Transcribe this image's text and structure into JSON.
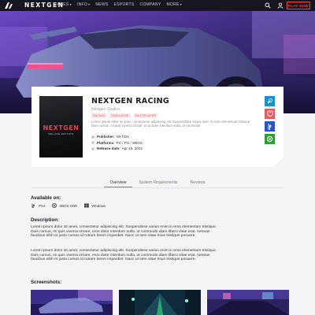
{
  "nav": {
    "brand": "NEXTGEN",
    "links": [
      {
        "label": "GAMES",
        "has_caret": true
      },
      {
        "label": "INFO",
        "has_caret": true
      },
      {
        "label": "NEWS",
        "has_caret": false
      },
      {
        "label": "ESPORTS",
        "has_caret": false
      },
      {
        "label": "COMPANY",
        "has_caret": false
      },
      {
        "label": "MORE",
        "has_caret": true
      }
    ],
    "caret": "▾",
    "icons": [
      "search-icon",
      "user-icon"
    ],
    "cta": "PLAY NOW",
    "cta_color": "#e8424c"
  },
  "game": {
    "title": "NEXTGEN RACING",
    "studio": "Nextgen Studios",
    "tags": [
      "racing",
      "simulator",
      "multiplayer"
    ],
    "blurb": "Lorem ipsum dolor sit amet, consectetur adipiscing elit. Suspendisse varius enim in eros elementum tristique. Duis cursus, mi quis viverra ornare, eros dolor interdum nulla, ut commodo",
    "cover": {
      "title": "NEXTGEN",
      "subtitle": "DELUXE EDITION"
    },
    "facts": [
      {
        "label": "Publisher:",
        "value": "NXTGN"
      },
      {
        "label": "Platforms:",
        "value": "PC / PS / XBOX"
      },
      {
        "label": "Release date:",
        "value": "Apr 25, 2022"
      }
    ],
    "stores": [
      {
        "name": "steam-icon",
        "color": "#1b8fd6"
      },
      {
        "name": "epic-icon",
        "color": "#e35b60"
      },
      {
        "name": "playstation-icon",
        "color": "#2456c6"
      },
      {
        "name": "xbox-icon",
        "color": "#2f9a3a"
      }
    ]
  },
  "tabs": [
    {
      "label": "Overview",
      "active": true
    },
    {
      "label": "System Requirements",
      "active": false
    },
    {
      "label": "Reviews",
      "active": false
    }
  ],
  "available": {
    "title": "Available on:",
    "platforms": [
      {
        "label": "PS4",
        "icon": "playstation-logo-icon"
      },
      {
        "label": "XBOX ONE",
        "icon": "xbox-logo-icon"
      },
      {
        "label": "Windows",
        "icon": "windows-logo-icon"
      }
    ]
  },
  "description": {
    "title": "Description:",
    "paragraphs": [
      "Lorem ipsum dolor sit amet, consectetur adipiscing elit. Suspendisse varius enim in eros elementum tristique. Duis cursus, mi quis viverra ornare, eros dolor interdum nulla, ut commodo diam libero vitae erat. Aenean faucibus nibh et justo cursus id rutrum lorem imperdiet. Nunc ut sem vitae risus tristique posuere.",
      "Lorem ipsum dolor sit amet, consectetur adipiscing elit. Suspendisse varius enim in eros elementum tristique. Duis cursus, mi quis viverra ornare, eros dolor interdum nulla, ut commodo diam libero vitae erat. Aenean faucibus nibh et justo cursus id rutrum lorem imperdiet. Nunc ut sem vitae risus tristique posuere."
    ]
  },
  "screenshots": {
    "title": "Screenshots:",
    "count": 3
  },
  "colors": {
    "accent": "#e35b60",
    "hero_purple": "#5d3aa6",
    "nav_bg": "#17151f"
  }
}
